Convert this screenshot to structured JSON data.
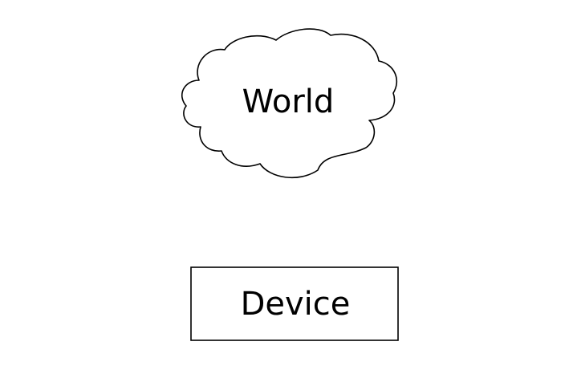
{
  "diagram": {
    "nodes": {
      "world": {
        "label": "World",
        "shape": "cloud"
      },
      "device": {
        "label": "Device",
        "shape": "rectangle"
      }
    }
  },
  "colors": {
    "background": "#ffffff",
    "stroke": "#000000",
    "fill": "#ffffff"
  }
}
